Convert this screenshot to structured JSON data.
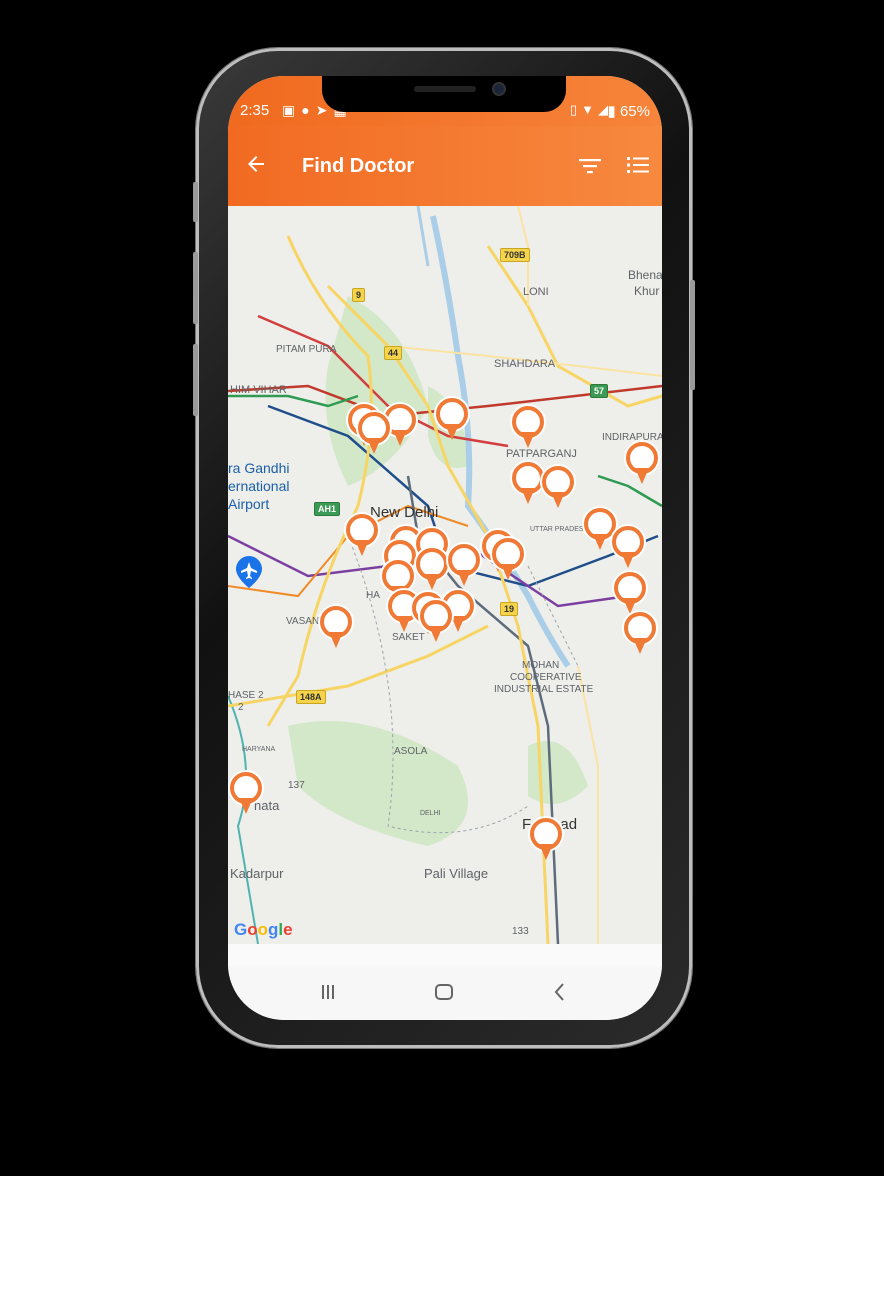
{
  "status": {
    "time": "2:35",
    "left_icons": [
      "image-icon",
      "bulb-icon",
      "send-icon",
      "calendar-icon"
    ],
    "right_icons": [
      "vibrate-icon",
      "wifi-icon",
      "signal-icon"
    ],
    "battery": "65%"
  },
  "appbar": {
    "title": "Find Doctor",
    "color_start": "#f26a22",
    "color_end": "#f7893f"
  },
  "map": {
    "labels": {
      "loni": "LONI",
      "bhena": "Bhena",
      "khur": "Khur",
      "pitampura": "PITAM PURA",
      "shahdara": "SHAHDARA",
      "vihar": "HIM VIHAR",
      "patparganj": "PATPARGANJ",
      "indirapuram": "INDIRAPURA",
      "airport1": "ra Gandhi",
      "airport2": "ernational",
      "airport3": "Airport",
      "newdelhi": "New Delhi",
      "vasant": "VASAN",
      "saket": "SAKET",
      "hauz": "HA",
      "mohan1": "MOHAN",
      "mohan2": "COOPERATIVE",
      "mohan3": "INDUSTRIAL ESTATE",
      "phase1": "HASE 2",
      "phase2": "2",
      "asola": "ASOLA",
      "nata": "nata",
      "faridabad": "Fa      abad",
      "kadarpur": "Kadarpur",
      "pali": "Pali Village",
      "haryana": "HARYANA",
      "delhi_border": "DELHI",
      "uttar": "UTTAR PRADESH"
    },
    "shields": {
      "s709b": "709B",
      "s9": "9",
      "s44": "44",
      "s57": "57",
      "sah1": "AH1",
      "s19": "19",
      "s148a": "148A",
      "s137": "137",
      "s133": "133"
    },
    "attribution": [
      "G",
      "o",
      "o",
      "g",
      "l",
      "e"
    ],
    "pin_color": "#f07a35"
  }
}
